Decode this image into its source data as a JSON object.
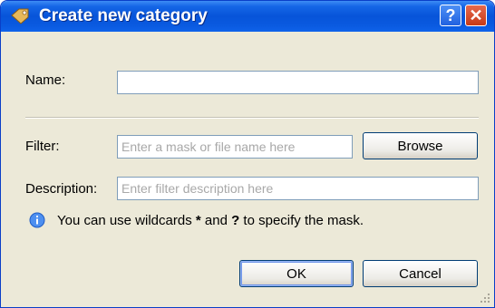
{
  "dialog": {
    "title": "Create new category",
    "help_button": "?",
    "close_button": "✕"
  },
  "form": {
    "name_label": "Name:",
    "name_value": "",
    "filter_label": "Filter:",
    "filter_value": "",
    "filter_placeholder": "Enter a mask or file name here",
    "browse_label": "Browse",
    "description_label": "Description:",
    "description_value": "",
    "description_placeholder": "Enter filter description here"
  },
  "hint": {
    "text_before": "You can use wildcards ",
    "wildcard_star": "*",
    "text_middle": " and ",
    "wildcard_question": "?",
    "text_after": " to specify the mask."
  },
  "buttons": {
    "ok_label": "OK",
    "cancel_label": "Cancel"
  },
  "colors": {
    "titlebar": "#0754d9",
    "dialog_bg": "#ece9d8",
    "close_button": "#c73a16"
  },
  "icons": {
    "title": "category-tag-icon",
    "hint": "info-icon"
  }
}
